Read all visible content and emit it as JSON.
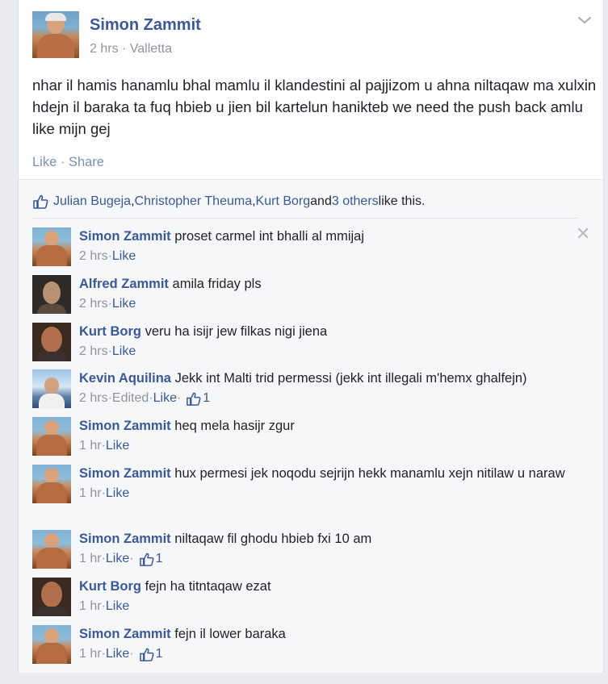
{
  "post": {
    "author": "Simon Zammit",
    "time": "2 hrs",
    "location": "Valletta",
    "meta_sep": " · ",
    "text": "nhar il hamis hanamlu bhal mamlu il klandestini al pajjizom u ahna niltaqaw ma xulxin hdejn il baraka ta fuq hbieb u jien bil kartelun hanikteb we need the push back amlu like mijn gej",
    "actions": {
      "like": "Like",
      "sep": " · ",
      "share": "Share"
    }
  },
  "likes": {
    "names": [
      "Julian Bugeja",
      "Christopher Theuma",
      "Kurt Borg"
    ],
    "comma": ", ",
    "and": " and ",
    "others": "3 others",
    "suffix": " like this."
  },
  "comments": [
    {
      "name": "Simon Zammit",
      "text": "proset carmel int bhalli al mmijaj",
      "time": "2 hrs",
      "like": "Like",
      "edited": "",
      "likes": ""
    },
    {
      "name": "Alfred Zammit",
      "text": "amila friday pls",
      "time": "2 hrs",
      "like": "Like",
      "edited": "",
      "likes": ""
    },
    {
      "name": "Kurt Borg",
      "text": "veru ha isijr jew filkas nigi jiena",
      "time": "2 hrs",
      "like": "Like",
      "edited": "",
      "likes": ""
    },
    {
      "name": "Kevin Aquilina",
      "text": "Jekk int Malti trid permessi (jekk int illegali m'hemx ghalfejn)",
      "time": "2 hrs",
      "like": "Like",
      "edited": "Edited",
      "likes": "1"
    },
    {
      "name": "Simon Zammit",
      "text": "heq mela hasijr zgur",
      "time": "1 hr",
      "like": "Like",
      "edited": "",
      "likes": ""
    },
    {
      "name": "Simon Zammit",
      "text": "hux permesi jek noqodu sejrijn hekk manamlu xejn nitilaw u naraw",
      "time": "1 hr",
      "like": "Like",
      "edited": "",
      "likes": ""
    },
    {
      "name": "Simon Zammit",
      "text": "niltaqaw fil ghodu hbieb fxi 10 am",
      "time": "1 hr",
      "like": "Like",
      "edited": "",
      "likes": "1"
    },
    {
      "name": "Kurt Borg",
      "text": "fejn ha titntaqaw ezat",
      "time": "1 hr",
      "like": "Like",
      "edited": "",
      "likes": ""
    },
    {
      "name": "Simon Zammit",
      "text": "fejn il lower baraka",
      "time": "1 hr",
      "like": "Like",
      "edited": "",
      "likes": "1"
    }
  ],
  "meta_sep": " · ",
  "icons": {
    "chevron": "chevron-down-icon",
    "close": "close-icon",
    "like_thumb": "thumbs-up-icon"
  },
  "colors": {
    "link": "#3b5998",
    "meta": "#90949c",
    "background": "#e9ebee"
  }
}
